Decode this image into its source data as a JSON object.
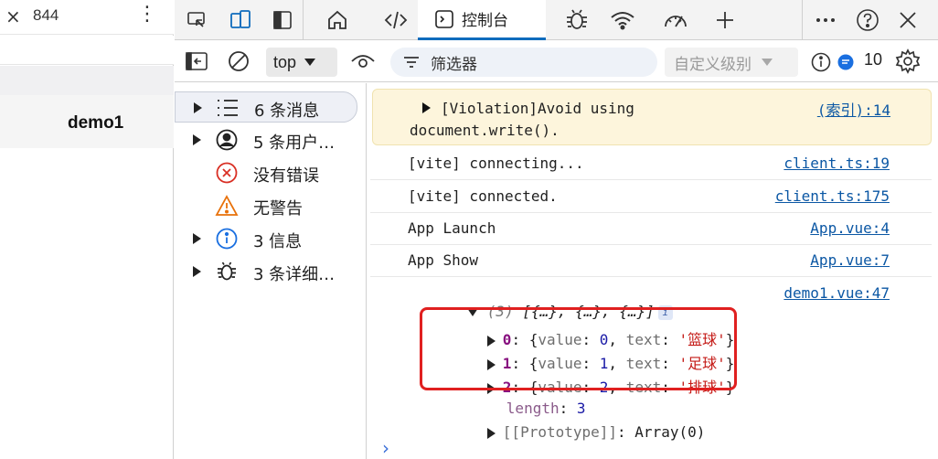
{
  "left_preview": {
    "close_glyph": "×",
    "device_width": "844",
    "menu_glyph": "⋮",
    "page_title": "demo1"
  },
  "toolbar": {
    "icons": [
      "inspect-element-icon",
      "device-toolbar-icon",
      "dock-side-icon",
      "welcome-home-icon",
      "elements-code-icon",
      "console-icon",
      "sources-bug-icon",
      "network-wifi-icon",
      "performance-gauge-icon",
      "more-tools-plus-icon",
      "more-options-icon",
      "help-icon",
      "close-icon"
    ],
    "active_tab": "控制台",
    "accent_color": "#0f6cbd"
  },
  "filter_bar": {
    "context": "top",
    "filter_placeholder": "筛选器",
    "levels": "自定义级别",
    "issue_count": "10"
  },
  "sidebar": {
    "items": [
      {
        "label": "6 条消息",
        "icon": "list-icon",
        "expandable": true,
        "selected": true
      },
      {
        "label": "5 条用户…",
        "icon": "user-icon",
        "expandable": true,
        "selected": false
      },
      {
        "label": "没有错误",
        "icon": "error-icon",
        "expandable": false,
        "selected": false
      },
      {
        "label": "无警告",
        "icon": "warning-icon",
        "expandable": false,
        "selected": false
      },
      {
        "label": "3 信息",
        "icon": "info-icon",
        "expandable": true,
        "selected": false
      },
      {
        "label": "3 条详细…",
        "icon": "verbose-bug-icon",
        "expandable": true,
        "selected": false
      }
    ]
  },
  "console": {
    "violation": {
      "line1": "[Violation]Avoid using",
      "line2": "document.write().",
      "source": "(索引):14",
      "background": "#fdf5dc"
    },
    "messages": [
      {
        "text": "[vite] connecting...",
        "source": "client.ts:19"
      },
      {
        "text": "[vite] connected.",
        "source": "client.ts:175"
      },
      {
        "text": "App Launch",
        "source": "App.vue:4"
      },
      {
        "text": "App Show",
        "source": "App.vue:7"
      }
    ],
    "array_log": {
      "summary_count": "(3)",
      "summary_preview": "[{…}, {…}, {…}]",
      "info_badge": "i",
      "source": "demo1.vue:47",
      "items": [
        {
          "index": "0",
          "value_key": "value",
          "value": "0",
          "text_key": "text",
          "text": "'篮球'"
        },
        {
          "index": "1",
          "value_key": "value",
          "value": "1",
          "text_key": "text",
          "text": "'足球'"
        },
        {
          "index": "2",
          "value_key": "value",
          "value": "2",
          "text_key": "text",
          "text": "'排球'"
        }
      ],
      "length_key": "length",
      "length_value": "3",
      "prototype_key": "[[Prototype]]",
      "prototype_value": "Array(0)"
    },
    "prompt_glyph": "›",
    "highlight_color": "#e02020"
  }
}
